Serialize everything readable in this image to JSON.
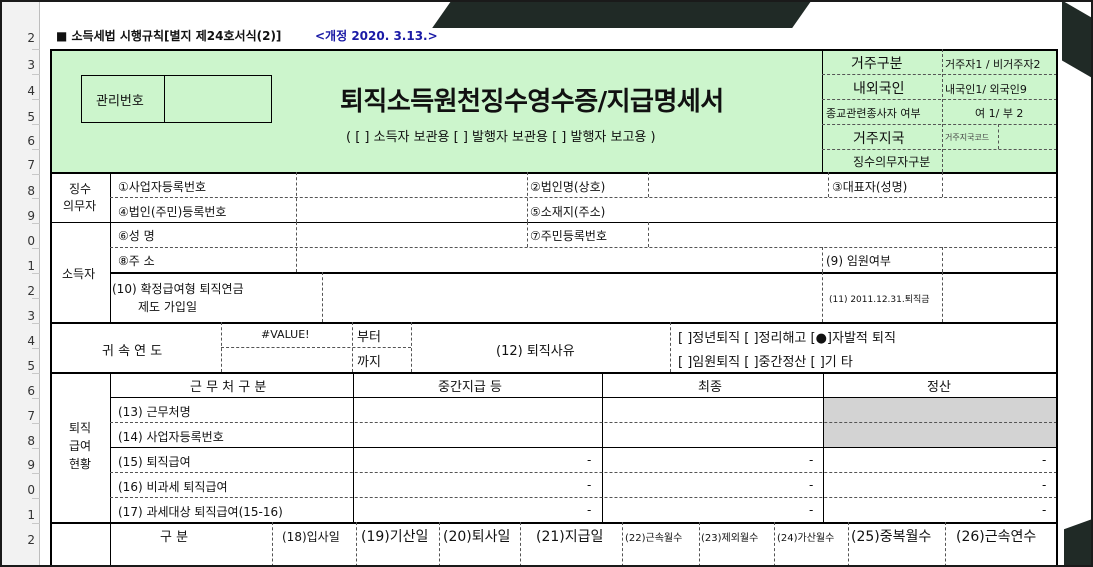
{
  "header": {
    "form_label": "■ 소득세법 시행규칙[별지 제24호서식(2)]",
    "amend_label": "<개정 2020. 3.13.>",
    "mgmt_no": "관리번호",
    "title": "퇴직소득원천징수영수증/지급명세서",
    "subtitle": "( [  ] 소득자 보관용   [  ] 발행자 보관용   [  ] 발행자 보고용 )"
  },
  "right_panel": {
    "residence": "거주구분",
    "residence_val": "거주자1 / 비거주자2",
    "nationality": "내외국인",
    "nationality_val": "내국인1/ 외국인9",
    "religion": "종교관련종사자 여부",
    "religion_val": "여 1/ 부 2",
    "country": "거주지국",
    "country_code": "거주지국코드",
    "withholder_type": "징수의무자구분"
  },
  "withholder": {
    "label1": "징수",
    "label2": "의무자",
    "biz_no": "①사업자등록번호",
    "corp_name": "②법인명(상호)",
    "rep": "③대표자(성명)",
    "corp_reg": "④법인(주민)등록번호",
    "address": "⑤소재지(주소)"
  },
  "recipient": {
    "label": "소득자",
    "name": "⑥성        명",
    "resident_no": "⑦주민등록번호",
    "address": "⑧주        소",
    "executive": "(9) 임원여부",
    "dc_line1": "(10) 확정급여형 퇴직연금",
    "dc_line2": "제도 가입일",
    "retire_2011": "(11) 2011.12.31.퇴직금"
  },
  "period": {
    "label": "귀 속 연 도",
    "value": "#VALUE!",
    "from": "부터",
    "to": "까지",
    "reason": "(12) 퇴직사유",
    "reason_line1": "[  ]정년퇴직 [  ]정리해고 [●]자발적 퇴직",
    "reason_line2": "[  ]임원퇴직 [  ]중간정산 [  ]기 타"
  },
  "pay": {
    "label1": "퇴직",
    "label2": "급여",
    "label3": "현황",
    "col_header": "근 무 처 구 분",
    "col_mid": "중간지급 등",
    "col_final": "최종",
    "col_settle": "정산",
    "rows": [
      {
        "label": "(13) 근무처명",
        "mid": "",
        "final": "",
        "settle": ""
      },
      {
        "label": "(14) 사업자등록번호",
        "mid": "",
        "final": "",
        "settle": ""
      },
      {
        "label": "(15) 퇴직급여",
        "mid": "-",
        "final": "-",
        "settle": "-"
      },
      {
        "label": "(16) 비과세 퇴직급여",
        "mid": "-",
        "final": "-",
        "settle": "-"
      },
      {
        "label": "(17) 과세대상 퇴직급여(15-16)",
        "mid": "-",
        "final": "-",
        "settle": "-"
      }
    ]
  },
  "bottom": {
    "c0": "구    분",
    "c1": "(18)입사일",
    "c2": "(19)기산일",
    "c3": "(20)퇴사일",
    "c4": "(21)지급일",
    "c5": "(22)근속월수",
    "c6": "(23)제외월수",
    "c7": "(24)가산월수",
    "c8": "(25)중복월수",
    "c9": "(26)근속연수"
  },
  "row_numbers": [
    "2",
    "3",
    "4",
    "5",
    "6",
    "7",
    "8",
    "9",
    "0",
    "1",
    "2",
    "3",
    "4",
    "5",
    "6",
    "7",
    "8",
    "9",
    "0",
    "1",
    "2"
  ],
  "colors": {
    "header_green": "#ccf5cc",
    "gray_cell": "#d3d3d3",
    "amend_blue": "#1a1aa6"
  }
}
